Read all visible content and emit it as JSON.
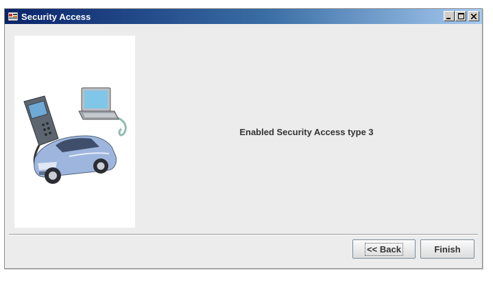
{
  "window": {
    "title": "Security Access",
    "icon": "app-icon",
    "controls": {
      "minimize_icon": "minimize-icon",
      "maximize_icon": "maximize-icon",
      "close_icon": "close-icon"
    }
  },
  "main": {
    "illustration": "scan-tool-laptop-car-illustration",
    "message": "Enabled Security Access type 3"
  },
  "footer": {
    "back_label": "<< Back",
    "finish_label": "Finish"
  }
}
